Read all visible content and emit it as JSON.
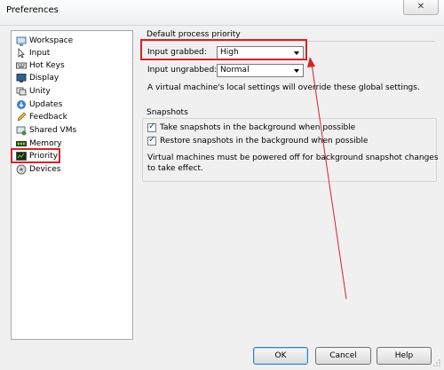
{
  "window": {
    "title": "Preferences",
    "close_glyph": "✕"
  },
  "sidebar": {
    "items": [
      {
        "label": "Workspace",
        "icon": "workspace-icon"
      },
      {
        "label": "Input",
        "icon": "input-icon"
      },
      {
        "label": "Hot Keys",
        "icon": "hotkeys-icon"
      },
      {
        "label": "Display",
        "icon": "display-icon"
      },
      {
        "label": "Unity",
        "icon": "unity-icon"
      },
      {
        "label": "Updates",
        "icon": "updates-icon"
      },
      {
        "label": "Feedback",
        "icon": "feedback-icon"
      },
      {
        "label": "Shared VMs",
        "icon": "shared-vms-icon"
      },
      {
        "label": "Memory",
        "icon": "memory-icon"
      },
      {
        "label": "Priority",
        "icon": "priority-icon"
      },
      {
        "label": "Devices",
        "icon": "devices-icon"
      }
    ],
    "selected": "Priority"
  },
  "priority": {
    "section_title": "Default process priority",
    "input_grabbed_label": "Input grabbed:",
    "input_grabbed_value": "High",
    "input_ungrabbed_label": "Input ungrabbed:",
    "input_ungrabbed_value": "Normal",
    "note": "A virtual machine's local settings will override these global settings."
  },
  "snapshots": {
    "section_title": "Snapshots",
    "take_label": "Take snapshots in the background when possible",
    "take_checked": true,
    "restore_label": "Restore snapshots in the background when possible",
    "restore_checked": true,
    "note_line1": "Virtual machines must be powered off for background snapshot changes",
    "note_line2": "to take effect."
  },
  "buttons": {
    "ok": "OK",
    "cancel": "Cancel",
    "help": "Help"
  },
  "colors": {
    "annotation_red": "#d6232a",
    "window_bg": "#f0f0f0"
  }
}
